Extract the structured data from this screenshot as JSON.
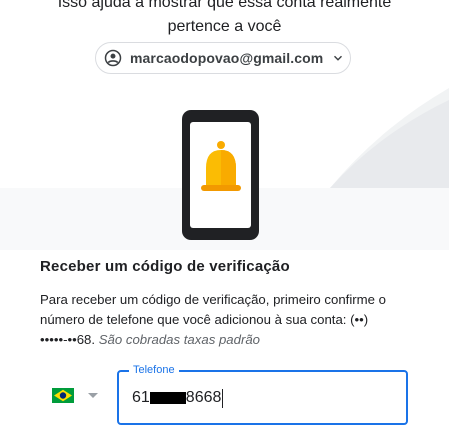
{
  "subtitle": {
    "line1": "Isso ajuda a mostrar que essa conta realmente",
    "line2": "pertence a você"
  },
  "account": {
    "email": "marcaodopovao@gmail.com"
  },
  "colors": {
    "accent": "#1a73e8",
    "bell": "#f9ab00",
    "brazil_green": "#009c3b",
    "brazil_yellow": "#ffdf00",
    "brazil_blue": "#002776"
  },
  "verification": {
    "heading": "Receber um código de verificação",
    "description_line1": "Para receber um código de verificação, primeiro confirme o",
    "description_line2": "número de telefone que você adicionou à sua conta: (••)",
    "description_line3_prefix": "•••••-••68.",
    "description_fee": "São cobradas taxas padrão"
  },
  "phone": {
    "country_icon": "brazil-flag-icon",
    "label": "Telefone",
    "value_prefix": "61",
    "value_suffix": "8668"
  }
}
